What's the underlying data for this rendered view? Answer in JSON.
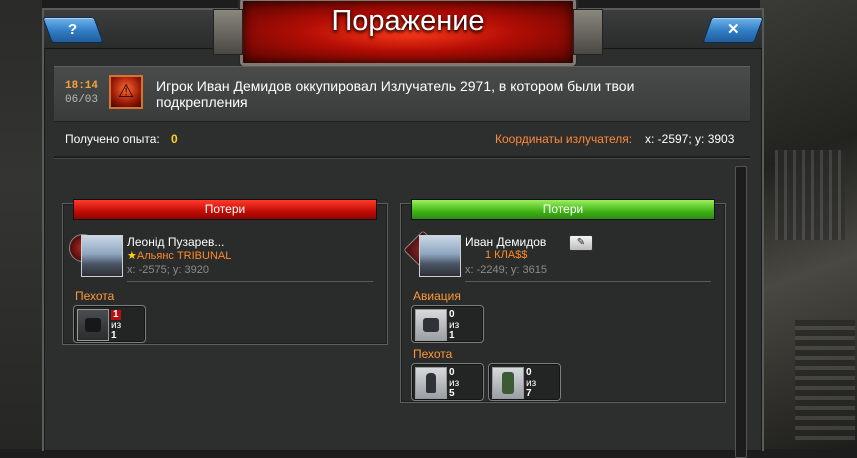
{
  "window": {
    "title": "Поражение",
    "help_label": "?",
    "close_label": "✕"
  },
  "notice": {
    "time": "18:14",
    "date": "06/03",
    "text": "Игрок Иван Демидов оккупировал Излучатель 2971, в котором были твои подкрепления",
    "icon": "defeat-icon"
  },
  "summary": {
    "exp_label": "Получено опыта:",
    "exp_value": "0",
    "coords_label": "Координаты излучателя:",
    "coords_value": "x: -2597; y: 3903"
  },
  "left_side": {
    "header": "Потери",
    "player": {
      "name": "Леонід Пузарев...",
      "alliance": "Альянс TRIBUNAL",
      "coords": "x: -2575; y: 3920"
    },
    "sections": [
      {
        "label": "Пехота",
        "units": [
          {
            "lost": "1",
            "of": "из",
            "total": "1",
            "kind": "armored-vehicle"
          }
        ]
      }
    ]
  },
  "right_side": {
    "header": "Потери",
    "player": {
      "name": "Иван Демидов",
      "alliance": "1 КЛА$$",
      "coords": "x: -2249; y: 3615"
    },
    "sections": [
      {
        "label": "Авиация",
        "units": [
          {
            "lost": "0",
            "of": "из",
            "total": "1",
            "kind": "drone"
          }
        ]
      },
      {
        "label": "Пехота",
        "units": [
          {
            "lost": "0",
            "of": "из",
            "total": "5",
            "kind": "soldier"
          },
          {
            "lost": "0",
            "of": "из",
            "total": "7",
            "kind": "mech-soldier"
          }
        ]
      }
    ]
  },
  "colors": {
    "accent_orange": "#ff8a3a",
    "loss_red": "#c10c06",
    "loss_green": "#45b81a",
    "button_blue": "#2f7cc4"
  }
}
